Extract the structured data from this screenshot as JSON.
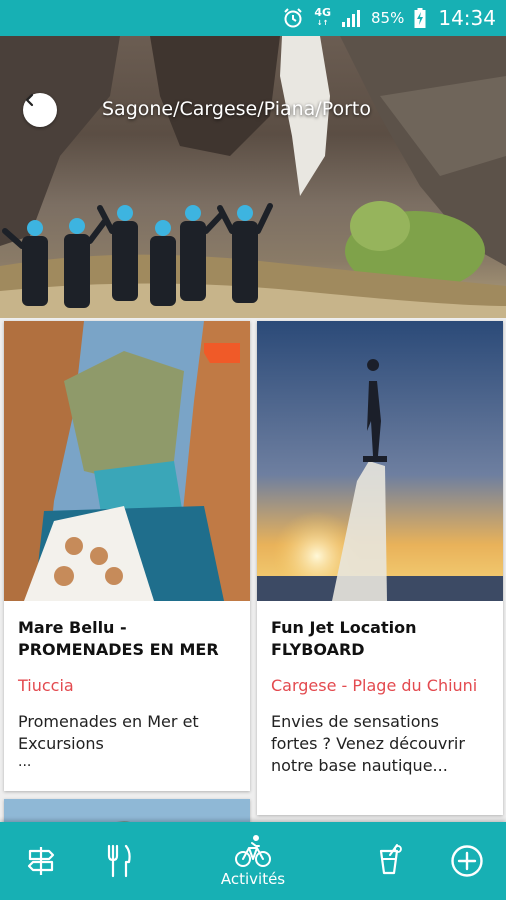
{
  "status_bar": {
    "network": "4G",
    "network_sub": "↓↑",
    "battery_percent": "85%",
    "time": "14:34",
    "icons": [
      "alarm-icon",
      "signal-icon",
      "battery-charging-icon"
    ]
  },
  "header": {
    "title": "Sagone/Cargese/Piana/Porto",
    "back_icon": "chevron-left-icon"
  },
  "cards": [
    {
      "name": "Mare Bellu - PROMENADES EN MER",
      "place": "Tiuccia",
      "description": "Promenades en Mer et Excursions",
      "more": "..."
    },
    {
      "name": "Fun Jet Location FLYBOARD",
      "place": "Cargese - Plage du Chiuni",
      "description": "Envies de sensations fortes ? Venez découvrir notre base nautique..."
    }
  ],
  "bottom_nav": {
    "items": [
      {
        "icon": "signpost-icon",
        "label": ""
      },
      {
        "icon": "fork-knife-icon",
        "label": ""
      },
      {
        "icon": "bicycle-icon",
        "label": "Activités",
        "active": true
      },
      {
        "icon": "cocktail-icon",
        "label": ""
      },
      {
        "icon": "plus-circle-icon",
        "label": ""
      }
    ]
  },
  "colors": {
    "primary": "#17b0b4",
    "place_text": "#e34a4f",
    "background": "#eeeeee"
  }
}
